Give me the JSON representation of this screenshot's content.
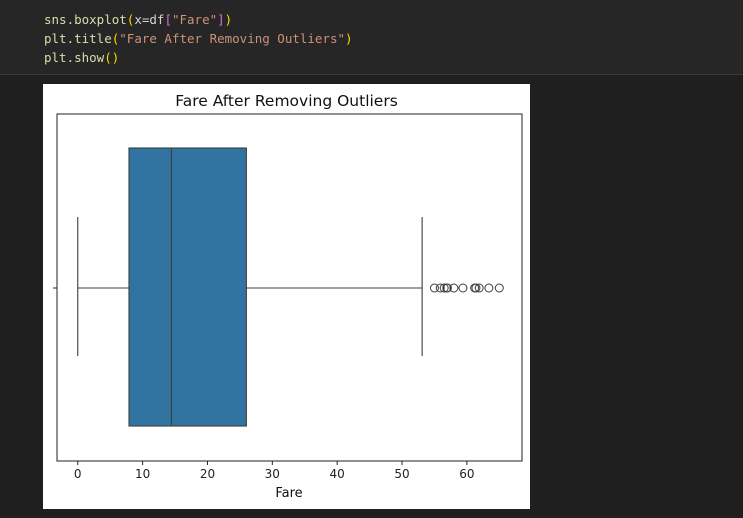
{
  "code": {
    "line1": {
      "fn": "sns.boxplot",
      "open": "(",
      "arg": "x=df",
      "lb": "[",
      "str": "\"Fare\"",
      "rb": "]",
      "close": ")"
    },
    "line2": {
      "fn": "plt.title",
      "open": "(",
      "str": "\"Fare After Removing Outliers\"",
      "close": ")"
    },
    "line3": {
      "fn": "plt.show",
      "open": "(",
      "close": ")"
    }
  },
  "chart_data": {
    "type": "boxplot",
    "title": "Fare After Removing Outliers",
    "xlabel": "Fare",
    "ylabel": "",
    "xlim": [
      -3.2,
      68.5
    ],
    "xticks": [
      0,
      10,
      20,
      30,
      40,
      50,
      60
    ],
    "box": {
      "whisker_low": 0,
      "q1": 7.9,
      "median": 14.45,
      "q3": 26.0,
      "whisker_high": 53.1,
      "color": "#3274a1"
    },
    "outliers": [
      55.0,
      55.9,
      56.5,
      56.9,
      57.0,
      58.0,
      59.4,
      61.2,
      61.4,
      61.9,
      63.4,
      65.0
    ]
  }
}
